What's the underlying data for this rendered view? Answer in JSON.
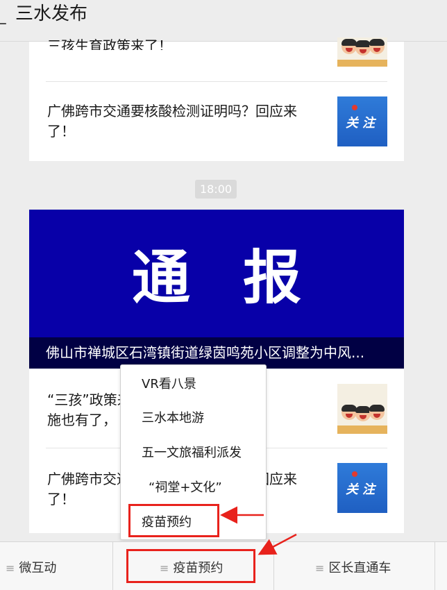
{
  "header": {
    "back_icon": "back-chevron-icon",
    "title": "三水发布"
  },
  "feed": {
    "prev_card": {
      "partial_title": "三孩生育政策来了！",
      "article": {
        "title_line1": "广佛跨市交通要核酸检测证明吗？回应来",
        "title_line2": "了！",
        "thumb_label": "关注"
      }
    },
    "timestamp": "18:00",
    "main_card": {
      "banner_text": "通报",
      "banner_caption": "佛山市禅城区石湾镇街道绿茵鸣苑小区调整为中风...",
      "articles": [
        {
          "title_line1": "“三孩”政策来了，配套支持措",
          "title_line2": "施也有了，",
          "thumb": "kids-illustration"
        },
        {
          "title_line1": "广佛跨市交通要核酸检测证明吗？回应来",
          "title_line2": "了！",
          "thumb_label": "关注"
        }
      ]
    }
  },
  "popup_menu": {
    "items": [
      "VR看八景",
      "三水本地游",
      "五一文旅福利派发",
      "“祠堂+文化”",
      "疫苗预约"
    ],
    "highlighted_index": 4
  },
  "bottom_menu": {
    "tabs": [
      "微互动",
      "疫苗预约",
      "区长直通车"
    ],
    "highlighted_index": 1
  },
  "colors": {
    "annotation": "#e8221c",
    "banner": "#0800a8",
    "background": "#ededed"
  }
}
